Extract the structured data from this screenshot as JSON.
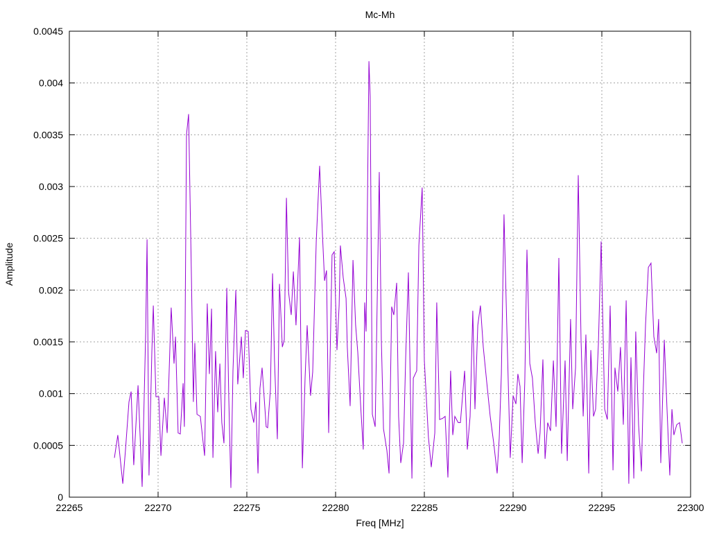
{
  "chart_data": {
    "type": "line",
    "title": "Mc-Mh",
    "xlabel": "Freq [MHz]",
    "ylabel": "Amplitude",
    "xlim": [
      22265,
      22300
    ],
    "ylim": [
      0,
      0.0045
    ],
    "xticks": [
      22265,
      22270,
      22275,
      22280,
      22285,
      22290,
      22295,
      22300
    ],
    "xtick_labels": [
      "22265",
      "22270",
      "22275",
      "22280",
      "22285",
      "22290",
      "22295",
      "22300"
    ],
    "yticks": [
      0,
      0.0005,
      0.001,
      0.0015,
      0.002,
      0.0025,
      0.003,
      0.0035,
      0.004,
      0.0045
    ],
    "ytick_labels": [
      "0",
      "0.0005",
      "0.001",
      "0.0015",
      "0.002",
      "0.0025",
      "0.003",
      "0.0035",
      "0.004",
      "0.0045"
    ],
    "grid": true,
    "legend": "none",
    "series": [
      {
        "name": "Mc-Mh",
        "color": "#9400d3",
        "points": [
          [
            22267.54,
            0.00038
          ],
          [
            22267.73,
            0.0006
          ],
          [
            22268.01,
            0.00013
          ],
          [
            22268.16,
            0.00045
          ],
          [
            22268.36,
            0.00092
          ],
          [
            22268.48,
            0.00102
          ],
          [
            22268.63,
            0.00031
          ],
          [
            22268.87,
            0.00108
          ],
          [
            22269.1,
            0.0001
          ],
          [
            22269.3,
            0.00159
          ],
          [
            22269.38,
            0.00249
          ],
          [
            22269.49,
            0.00021
          ],
          [
            22269.65,
            0.0014
          ],
          [
            22269.73,
            0.00185
          ],
          [
            22269.88,
            0.00097
          ],
          [
            22270.04,
            0.00097
          ],
          [
            22270.16,
            0.0004
          ],
          [
            22270.35,
            0.00096
          ],
          [
            22270.51,
            0.00062
          ],
          [
            22270.74,
            0.00183
          ],
          [
            22270.9,
            0.00129
          ],
          [
            22270.98,
            0.00155
          ],
          [
            22271.13,
            0.00062
          ],
          [
            22271.25,
            0.00061
          ],
          [
            22271.41,
            0.0011
          ],
          [
            22271.48,
            0.00068
          ],
          [
            22271.6,
            0.0035
          ],
          [
            22271.72,
            0.0037
          ],
          [
            22271.88,
            0.00212
          ],
          [
            22271.99,
            0.00092
          ],
          [
            22272.07,
            0.00149
          ],
          [
            22272.19,
            0.0008
          ],
          [
            22272.38,
            0.00078
          ],
          [
            22272.62,
            0.0004
          ],
          [
            22272.77,
            0.00187
          ],
          [
            22272.89,
            0.00119
          ],
          [
            22273.01,
            0.00182
          ],
          [
            22273.09,
            0.00038
          ],
          [
            22273.24,
            0.00141
          ],
          [
            22273.36,
            0.00082
          ],
          [
            22273.48,
            0.00129
          ],
          [
            22273.59,
            0.00072
          ],
          [
            22273.71,
            0.00052
          ],
          [
            22273.87,
            0.00202
          ],
          [
            22273.98,
            0.00098
          ],
          [
            22274.1,
            9e-05
          ],
          [
            22274.22,
            0.00122
          ],
          [
            22274.38,
            0.002
          ],
          [
            22274.49,
            0.00109
          ],
          [
            22274.69,
            0.00155
          ],
          [
            22274.8,
            0.00115
          ],
          [
            22274.92,
            0.00161
          ],
          [
            22275.08,
            0.0016
          ],
          [
            22275.23,
            0.00085
          ],
          [
            22275.39,
            0.00072
          ],
          [
            22275.51,
            0.00092
          ],
          [
            22275.63,
            0.00023
          ],
          [
            22275.74,
            0.00105
          ],
          [
            22275.86,
            0.00125
          ],
          [
            22276.09,
            0.00068
          ],
          [
            22276.17,
            0.00067
          ],
          [
            22276.33,
            0.00104
          ],
          [
            22276.45,
            0.00216
          ],
          [
            22276.56,
            0.00132
          ],
          [
            22276.72,
            0.00056
          ],
          [
            22276.84,
            0.00206
          ],
          [
            22277.0,
            0.00145
          ],
          [
            22277.11,
            0.00152
          ],
          [
            22277.23,
            0.00289
          ],
          [
            22277.35,
            0.00198
          ],
          [
            22277.5,
            0.00176
          ],
          [
            22277.62,
            0.00218
          ],
          [
            22277.77,
            0.00166
          ],
          [
            22277.97,
            0.00251
          ],
          [
            22278.13,
            0.00028
          ],
          [
            22278.28,
            0.00115
          ],
          [
            22278.4,
            0.00166
          ],
          [
            22278.59,
            0.00098
          ],
          [
            22278.71,
            0.00121
          ],
          [
            22278.91,
            0.00247
          ],
          [
            22279.1,
            0.0032
          ],
          [
            22279.26,
            0.00253
          ],
          [
            22279.38,
            0.00209
          ],
          [
            22279.49,
            0.00219
          ],
          [
            22279.61,
            0.00062
          ],
          [
            22279.8,
            0.00234
          ],
          [
            22279.92,
            0.00237
          ],
          [
            22280.08,
            0.00142
          ],
          [
            22280.2,
            0.00185
          ],
          [
            22280.27,
            0.00243
          ],
          [
            22280.43,
            0.00212
          ],
          [
            22280.59,
            0.00192
          ],
          [
            22280.66,
            0.00145
          ],
          [
            22280.82,
            0.00088
          ],
          [
            22280.98,
            0.00229
          ],
          [
            22281.13,
            0.00166
          ],
          [
            22281.25,
            0.0014
          ],
          [
            22281.41,
            0.00089
          ],
          [
            22281.56,
            0.00046
          ],
          [
            22281.64,
            0.00188
          ],
          [
            22281.72,
            0.0016
          ],
          [
            22281.88,
            0.00421
          ],
          [
            22281.95,
            0.00387
          ],
          [
            22282.07,
            0.0008
          ],
          [
            22282.23,
            0.00068
          ],
          [
            22282.46,
            0.00314
          ],
          [
            22282.58,
            0.00152
          ],
          [
            22282.7,
            0.00066
          ],
          [
            22282.89,
            0.00045
          ],
          [
            22283.01,
            0.00023
          ],
          [
            22283.16,
            0.00184
          ],
          [
            22283.28,
            0.00176
          ],
          [
            22283.44,
            0.00207
          ],
          [
            22283.55,
            0.00078
          ],
          [
            22283.67,
            0.00033
          ],
          [
            22283.83,
            0.00052
          ],
          [
            22283.95,
            0.00135
          ],
          [
            22284.1,
            0.00217
          ],
          [
            22284.3,
            0.00018
          ],
          [
            22284.38,
            0.00115
          ],
          [
            22284.57,
            0.00122
          ],
          [
            22284.69,
            0.00243
          ],
          [
            22284.88,
            0.00299
          ],
          [
            22285.0,
            0.00132
          ],
          [
            22285.23,
            0.00058
          ],
          [
            22285.39,
            0.00029
          ],
          [
            22285.59,
            0.00062
          ],
          [
            22285.7,
            0.00188
          ],
          [
            22285.86,
            0.00075
          ],
          [
            22286.02,
            0.00076
          ],
          [
            22286.17,
            0.00078
          ],
          [
            22286.33,
            0.00019
          ],
          [
            22286.48,
            0.00122
          ],
          [
            22286.6,
            0.0006
          ],
          [
            22286.72,
            0.00078
          ],
          [
            22286.91,
            0.00072
          ],
          [
            22287.03,
            0.00072
          ],
          [
            22287.27,
            0.00122
          ],
          [
            22287.42,
            0.00046
          ],
          [
            22287.58,
            0.00078
          ],
          [
            22287.73,
            0.0018
          ],
          [
            22287.85,
            0.00085
          ],
          [
            22288.01,
            0.00166
          ],
          [
            22288.16,
            0.00185
          ],
          [
            22288.32,
            0.00145
          ],
          [
            22288.55,
            0.00105
          ],
          [
            22288.71,
            0.00078
          ],
          [
            22288.91,
            0.00052
          ],
          [
            22289.1,
            0.00023
          ],
          [
            22289.22,
            0.00057
          ],
          [
            22289.34,
            0.00119
          ],
          [
            22289.49,
            0.00273
          ],
          [
            22289.65,
            0.00163
          ],
          [
            22289.84,
            0.00038
          ],
          [
            22290.0,
            0.00098
          ],
          [
            22290.16,
            0.0009
          ],
          [
            22290.27,
            0.00119
          ],
          [
            22290.39,
            0.00107
          ],
          [
            22290.51,
            0.00033
          ],
          [
            22290.66,
            0.00112
          ],
          [
            22290.78,
            0.00239
          ],
          [
            22290.94,
            0.00129
          ],
          [
            22291.09,
            0.00115
          ],
          [
            22291.25,
            0.00072
          ],
          [
            22291.41,
            0.00042
          ],
          [
            22291.52,
            0.00062
          ],
          [
            22291.68,
            0.00133
          ],
          [
            22291.8,
            0.00037
          ],
          [
            22291.95,
            0.00072
          ],
          [
            22292.11,
            0.00064
          ],
          [
            22292.27,
            0.00132
          ],
          [
            22292.42,
            0.00068
          ],
          [
            22292.58,
            0.00231
          ],
          [
            22292.73,
            0.00042
          ],
          [
            22292.93,
            0.00132
          ],
          [
            22293.05,
            0.00035
          ],
          [
            22293.24,
            0.00172
          ],
          [
            22293.36,
            0.00085
          ],
          [
            22293.52,
            0.00125
          ],
          [
            22293.67,
            0.00311
          ],
          [
            22293.83,
            0.00152
          ],
          [
            22293.95,
            0.00078
          ],
          [
            22294.1,
            0.00157
          ],
          [
            22294.26,
            0.00023
          ],
          [
            22294.38,
            0.00142
          ],
          [
            22294.53,
            0.00078
          ],
          [
            22294.65,
            0.00085
          ],
          [
            22294.81,
            0.00149
          ],
          [
            22294.96,
            0.00247
          ],
          [
            22295.16,
            0.00085
          ],
          [
            22295.31,
            0.00075
          ],
          [
            22295.47,
            0.00185
          ],
          [
            22295.63,
            0.00026
          ],
          [
            22295.74,
            0.00125
          ],
          [
            22295.9,
            0.00102
          ],
          [
            22296.05,
            0.00145
          ],
          [
            22296.21,
            0.0007
          ],
          [
            22296.37,
            0.0019
          ],
          [
            22296.52,
            0.00013
          ],
          [
            22296.64,
            0.00135
          ],
          [
            22296.8,
            0.00018
          ],
          [
            22296.91,
            0.0016
          ],
          [
            22297.07,
            0.0007
          ],
          [
            22297.23,
            0.00025
          ],
          [
            22297.34,
            0.00105
          ],
          [
            22297.46,
            0.00166
          ],
          [
            22297.62,
            0.00222
          ],
          [
            22297.77,
            0.00226
          ],
          [
            22297.93,
            0.00155
          ],
          [
            22298.09,
            0.00139
          ],
          [
            22298.2,
            0.00172
          ],
          [
            22298.32,
            0.00033
          ],
          [
            22298.52,
            0.00152
          ],
          [
            22298.67,
            0.00085
          ],
          [
            22298.83,
            0.00021
          ],
          [
            22298.95,
            0.00085
          ],
          [
            22299.06,
            0.0006
          ],
          [
            22299.22,
            0.0007
          ],
          [
            22299.38,
            0.00072
          ],
          [
            22299.53,
            0.00052
          ]
        ]
      }
    ]
  }
}
